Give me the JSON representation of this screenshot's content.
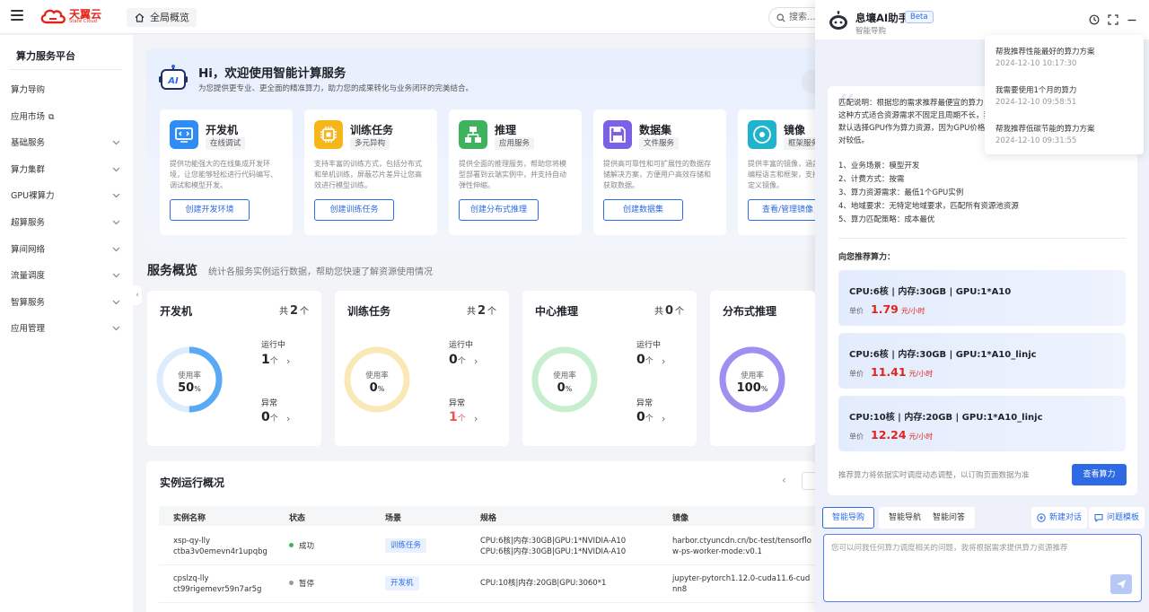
{
  "topbar": {
    "brand_cn": "天翼云",
    "brand_en": "State Cloud",
    "tab_label": "全局概览",
    "search_text": "搜索..."
  },
  "sidebar": {
    "title": "算力服务平台",
    "items": [
      {
        "label": "算力导购",
        "expandable": false
      },
      {
        "label": "应用市场",
        "expandable": false,
        "external": true
      },
      {
        "label": "基础服务",
        "expandable": true
      },
      {
        "label": "算力集群",
        "expandable": true
      },
      {
        "label": "GPU裸算力",
        "expandable": true
      },
      {
        "label": "超算服务",
        "expandable": true
      },
      {
        "label": "算间网络",
        "expandable": true
      },
      {
        "label": "流量调度",
        "expandable": true
      },
      {
        "label": "智算服务",
        "expandable": true
      },
      {
        "label": "应用管理",
        "expandable": true
      }
    ]
  },
  "banner": {
    "ai_text": "AI",
    "title": "Hi，欢迎使用智能计算服务",
    "subtitle": "为您提供更专业、更全面的精准算力，助力您的成果转化与业务闭环的完美结合。",
    "services": [
      {
        "name": "开发机",
        "tag": "在线调试",
        "desc": "提供功能强大的在线集成开发环境，让您能够轻松进行代码编写、调试和模型开发。",
        "button": "创建开发环境",
        "color": "#2f8cf4",
        "icon": "monitor-code-icon"
      },
      {
        "name": "训练任务",
        "tag": "多元异构",
        "desc": "支持丰富的训练方式，包括分布式和单机训练，屏蔽芯片差异让您高效进行模型训练。",
        "button": "创建训练任务",
        "color": "#f6b619",
        "icon": "chip-icon"
      },
      {
        "name": "推理",
        "tag": "应用服务",
        "desc": "提供全面的推理服务，帮助您将模型部署到云端实例中，并支持自动弹性伸缩。",
        "button": "创建分布式推理",
        "color": "#3cb35c",
        "icon": "hierarchy-icon"
      },
      {
        "name": "数据集",
        "tag": "文件服务",
        "desc": "提供高可靠性和可扩展性的数据存储解决方案，方便用户高效存储和获取数据。",
        "button": "创建数据集",
        "color": "#7b61e8",
        "icon": "save-disk-icon"
      },
      {
        "name": "镜像",
        "tag": "框架服务",
        "desc": "提供丰富的镜像，涵盖操作系统、编程语言和框架，支持用户使用自定义镜像。",
        "button": "查看/管理镜像",
        "color": "#1fb3cc",
        "icon": "disc-icon"
      }
    ]
  },
  "overview": {
    "title": "服务概览",
    "subtitle": "统计各服务实例运行数据，帮助您快速了解资源使用情况",
    "total_prefix": "共",
    "unit": "个",
    "usage_label": "使用率",
    "running_label": "运行中",
    "abnormal_label": "异常",
    "cards": [
      {
        "title": "开发机",
        "total": "2",
        "usage": "50",
        "running": "1",
        "abnormal": "0",
        "ring_color": "#5aa9f5",
        "track_color": "#dcecfc"
      },
      {
        "title": "训练任务",
        "total": "2",
        "usage": "0",
        "running": "0",
        "abnormal": "1",
        "ring_color": "#f5d77a",
        "track_color": "#fbf1d1"
      },
      {
        "title": "中心推理",
        "total": "0",
        "usage": "0",
        "running": "0",
        "abnormal": "0",
        "ring_color": "#9be0a9",
        "track_color": "#ddf5e1"
      },
      {
        "title": "分布式推理",
        "total": "",
        "usage": "100",
        "running": "",
        "abnormal": "",
        "ring_color": "#a08ef0",
        "track_color": "#e6e0fb"
      }
    ]
  },
  "instances": {
    "title": "实例运行概况",
    "headers": [
      "实例名称",
      "状态",
      "场景",
      "规格",
      "镜像"
    ],
    "rows": [
      {
        "name1": "xsp-qy-lly",
        "name2": "ctba3v0emevn4r1upqbg",
        "status": "成功",
        "status_color": "#3cb35c",
        "scene": "训练任务",
        "spec1": "CPU:6核|内存:30GB|GPU:1*NVIDIA-A10",
        "spec2": "CPU:6核|内存:30GB|GPU:1*NVIDIA-A10",
        "image1": "harbor.ctyuncdn.cn/bc-test/tensorflo",
        "image2": "w-ps-worker-mode:v0.1"
      },
      {
        "name1": "cpslzq-lly",
        "name2": "ct99rigemevr59n7ar5g",
        "status": "暂停",
        "status_color": "#999999",
        "scene": "开发机",
        "spec1": "CPU:10核|内存:20GB|GPU:3060*1",
        "spec2": "",
        "image1": "jupyter-pytorch1.12.0-cuda11.6-cud",
        "image2": "nn8"
      }
    ]
  },
  "assistant": {
    "name": "息壤AI助手",
    "beta": "Beta",
    "subtitle": "智能导购",
    "history": [
      {
        "question": "帮我推荐性能最好的算力方案",
        "time": "2024-12-10 10:17:30"
      },
      {
        "question": "我需要使用1个月的算力",
        "time": "2024-12-10 09:58:51"
      },
      {
        "question": "帮我推荐低碳节能的算力方案",
        "time": "2024-12-10 09:31:55"
      }
    ],
    "explain": "匹配说明：根据您的需求推荐最便宜的算力，为这种方式适合资源需求不固定且周期不长，我们默认选择GPU作为算力资源，因为GPU价格相对较低。",
    "criteria": [
      "1、业务场景：模型开发",
      "2、计费方式：按需",
      "3、算力资源需求：最低1个GPU实例",
      "4、地域要求：无特定地域要求，匹配所有资源池资源",
      "5、算力匹配策略：成本最优"
    ],
    "recommend_title": "向您推荐算力：",
    "price_label": "单价",
    "price_unit": "元/小时",
    "recommendations": [
      {
        "spec": "CPU:6核 | 内存:30GB | GPU:1*A10",
        "price": "1.79"
      },
      {
        "spec": "CPU:6核 | 内存:30GB | GPU:1*A10_linjc",
        "price": "11.41"
      },
      {
        "spec": "CPU:10核 | 内存:20GB | GPU:1*A10_linjc",
        "price": "12.24"
      }
    ],
    "footnote": "推荐算力将依据实时调度动态调整，以订购页面数据为准",
    "view_button": "查看算力",
    "tabs": [
      "智能导购",
      "智能导航",
      "智能问答"
    ],
    "new_chat": "新建对话",
    "templates": "问题模板",
    "input_placeholder": "您可以问我任何算力调度相关的问题，我将根据需求提供算力资源推荐"
  },
  "colors": {
    "primary": "#2d6ae3",
    "brand_red": "#e2231a",
    "alert_red": "#f5504c"
  }
}
